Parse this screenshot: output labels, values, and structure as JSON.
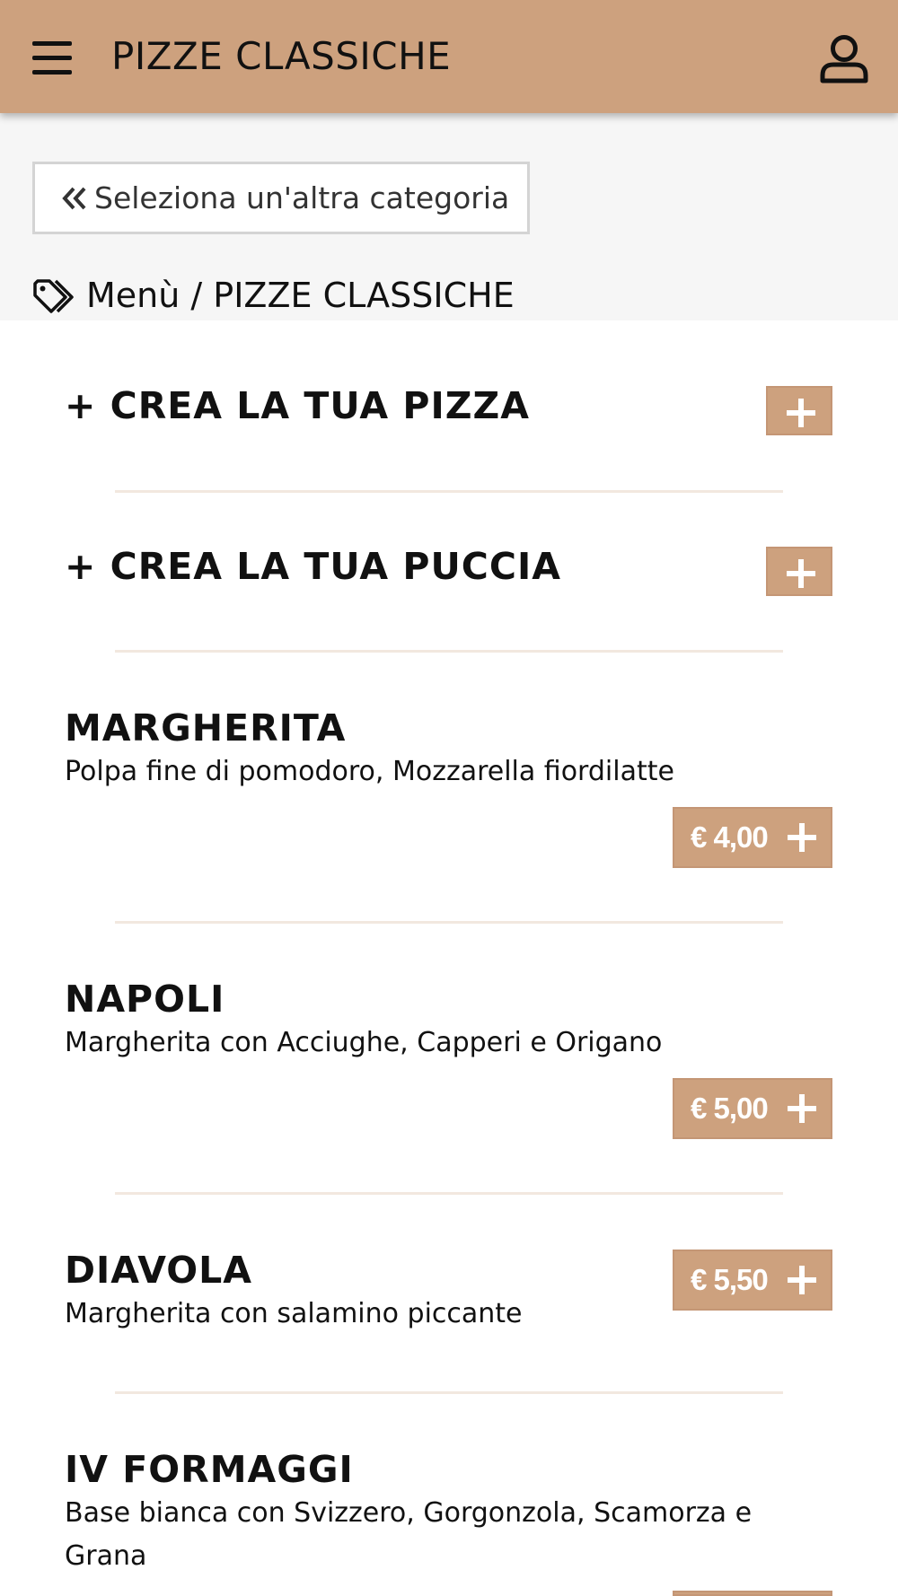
{
  "header": {
    "title": "PIZZE CLASSICHE",
    "menu_icon": "hamburger-menu-icon",
    "user_icon": "user-icon",
    "background_color": "#cda17e"
  },
  "back_button": {
    "label": "Seleziona un'altra categoria",
    "icon": "double-chevron-left-icon"
  },
  "breadcrumb": {
    "icon": "tag-icon",
    "text": "Menù / PIZZE CLASSICHE"
  },
  "builders": [
    {
      "label": "+ CREA LA TUA PIZZA",
      "button_icon": "plus-icon"
    },
    {
      "label": "+ CREA LA TUA PUCCIA",
      "button_icon": "plus-icon"
    }
  ],
  "products": [
    {
      "name": "MARGHERITA",
      "description": "Polpa fine di pomodoro, Mozzarella fiordilatte",
      "price": "€ 4,00"
    },
    {
      "name": "NAPOLI",
      "description": "Margherita con Acciughe, Capperi e Origano",
      "price": "€ 5,00"
    },
    {
      "name": "DIAVOLA",
      "description": "Margherita con salamino piccante",
      "price": "€ 5,50"
    },
    {
      "name": "IV FORMAGGI",
      "description": "Base bianca con Svizzero, Gorgonzola, Scamorza e Grana",
      "price": ""
    }
  ],
  "colors": {
    "accent": "#cda17e",
    "divider": "#f2e8df",
    "top_background": "#f6f6f6"
  }
}
